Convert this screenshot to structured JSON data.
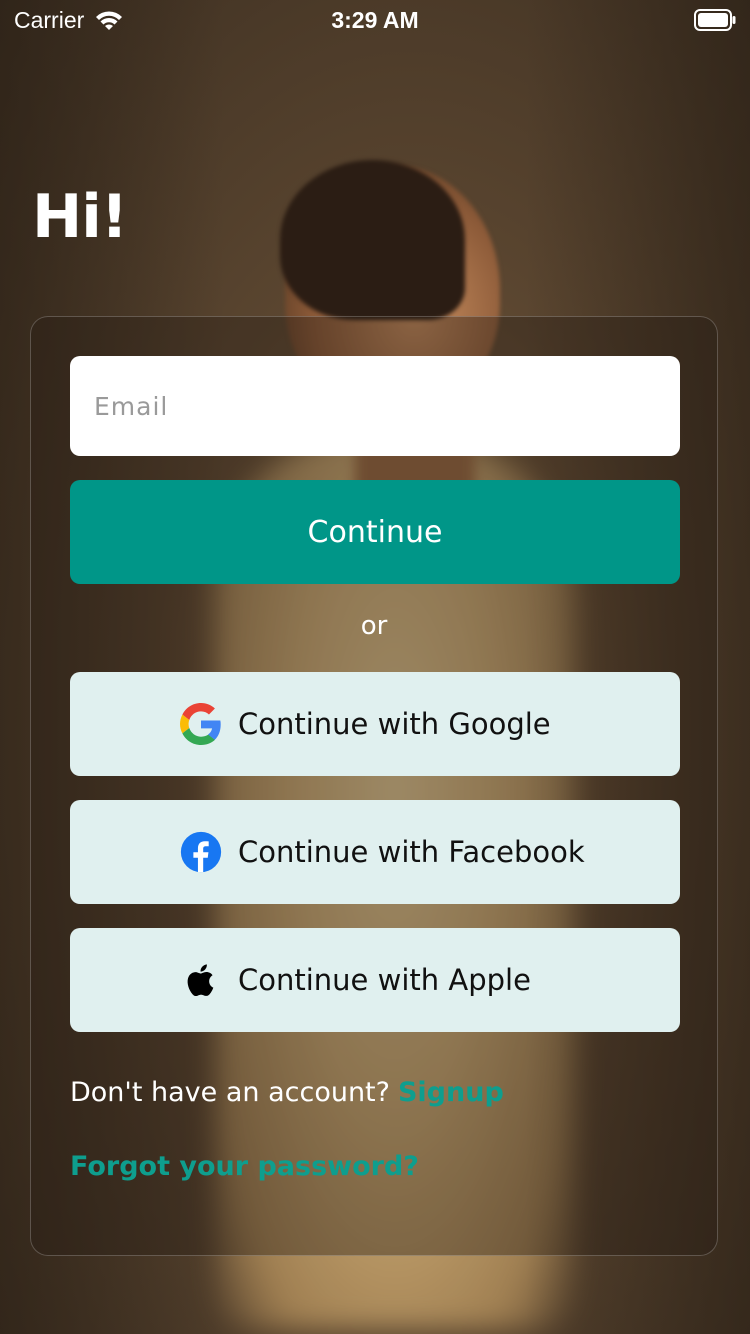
{
  "status_bar": {
    "carrier": "Carrier",
    "time": "3:29 AM",
    "wifi_icon": "wifi-icon",
    "battery_icon": "battery-icon"
  },
  "greeting": "Hi!",
  "form": {
    "email_placeholder": "Email",
    "email_value": "",
    "continue_label": "Continue",
    "or_label": "or"
  },
  "social": [
    {
      "label": "Continue with Google",
      "icon": "google-icon"
    },
    {
      "label": "Continue with Facebook",
      "icon": "facebook-icon"
    },
    {
      "label": "Continue with Apple",
      "icon": "apple-icon"
    }
  ],
  "footer": {
    "no_account_text": "Don't have an account?",
    "signup_label": "Signup",
    "forgot_label": "Forgot your password?"
  },
  "colors": {
    "accent": "#009688",
    "link": "#0e9e8e",
    "social_button_bg": "#e0f0ef"
  }
}
